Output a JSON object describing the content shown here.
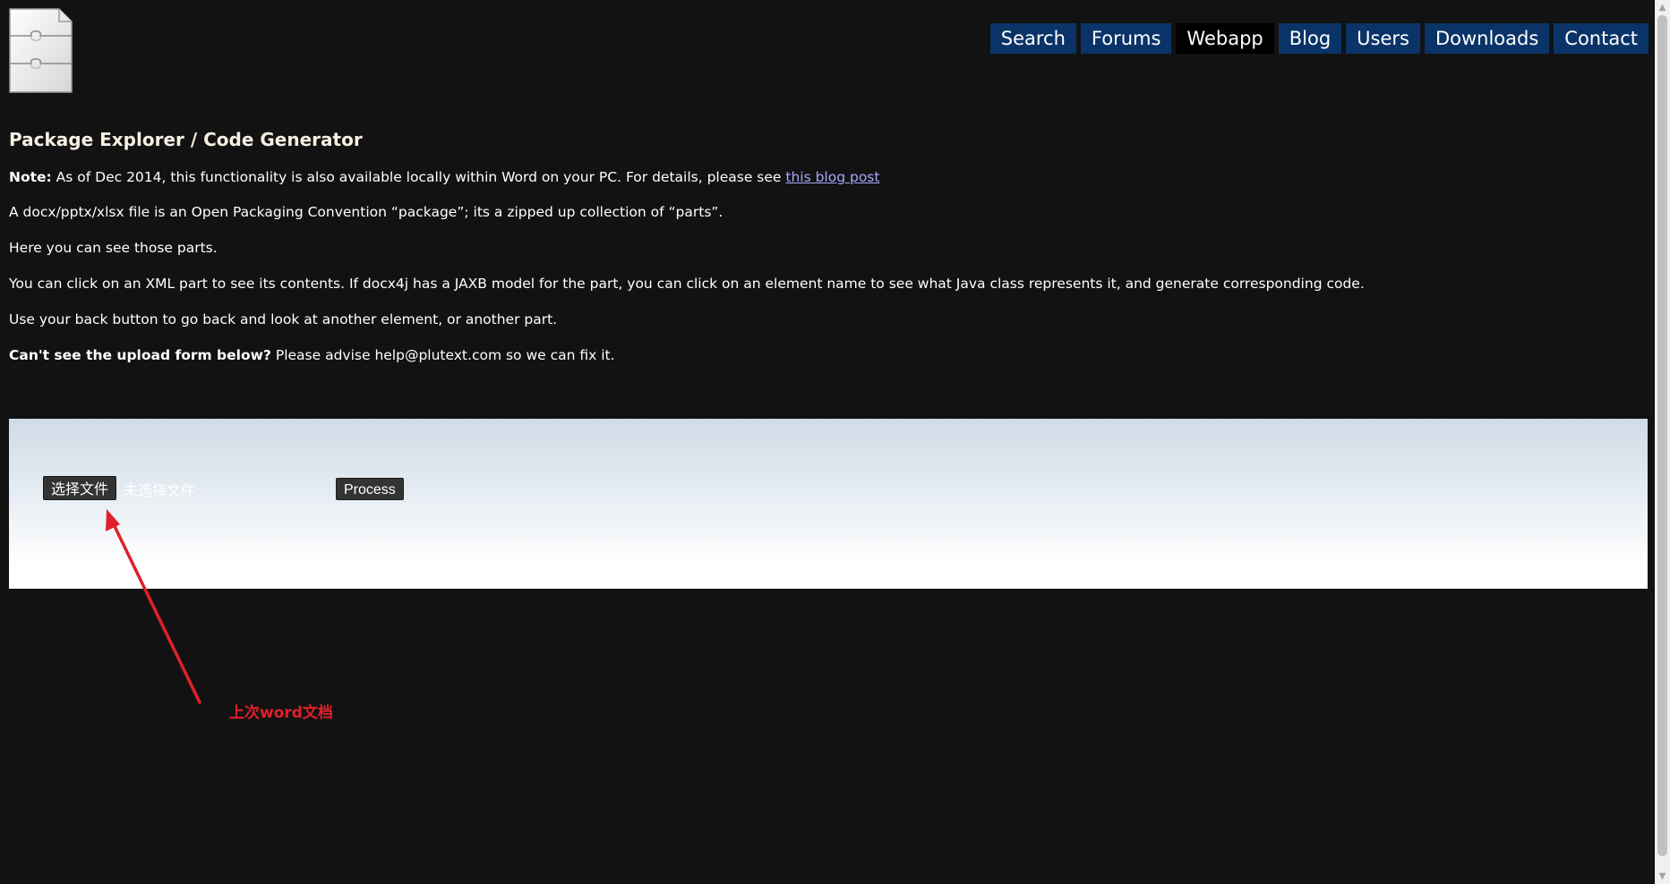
{
  "nav": {
    "items": [
      {
        "label": "Search"
      },
      {
        "label": "Forums"
      },
      {
        "label": "Webapp",
        "active": true
      },
      {
        "label": "Blog"
      },
      {
        "label": "Users"
      },
      {
        "label": "Downloads"
      },
      {
        "label": "Contact"
      }
    ]
  },
  "logo": {
    "icon": "puzzle-document-icon"
  },
  "content": {
    "title": "Package Explorer / Code Generator",
    "note_label": "Note:",
    "note_text": " As of Dec 2014, this functionality is also available locally within Word on your PC. For details, please see ",
    "note_link": "this blog post",
    "para1": "A docx/pptx/xlsx file is an Open Packaging Convention “package”; its a zipped up collection of “parts”.",
    "para2": "Here you can see those parts.",
    "para3": "You can click on an XML part to see its contents. If docx4j has a JAXB model for the part, you can click on an element name to see what Java class represents it, and generate corresponding code.",
    "para4": "Use your back button to go back and look at another element, or another part.",
    "upload_label": "Can't see the upload form below?",
    "upload_text": " Please advise help@plutext.com so we can fix it."
  },
  "upload_form": {
    "choose_file_label": "选择文件",
    "file_status": "未选择文件",
    "process_label": "Process"
  },
  "annotation": {
    "text": "上次word文档",
    "color": "#e0202a"
  },
  "colors": {
    "background": "#121212",
    "nav_bg": "#0a3468",
    "nav_active_bg": "#000000",
    "title_color": "#f6efe2",
    "link_color": "#a7a7ff"
  }
}
